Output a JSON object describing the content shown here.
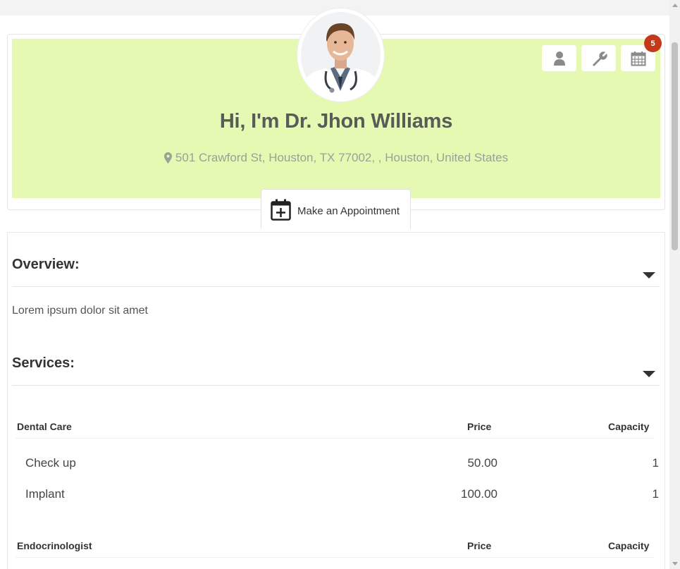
{
  "profile": {
    "name": "Hi, I'm Dr. Jhon Williams",
    "address": "501 Crawford St, Houston, TX 77002, , Houston, United States",
    "notification_count": "5"
  },
  "appointment": {
    "label": "Make an Appointment"
  },
  "overview": {
    "title": "Overview:",
    "text": "Lorem ipsum dolor sit amet"
  },
  "services": {
    "title": "Services:",
    "price_header": "Price",
    "capacity_header": "Capacity",
    "groups": [
      {
        "name": "Dental Care",
        "rows": [
          {
            "service": "Check up",
            "price": "50.00",
            "capacity": "1"
          },
          {
            "service": "Implant",
            "price": "100.00",
            "capacity": "1"
          }
        ]
      },
      {
        "name": "Endocrinologist",
        "rows": []
      }
    ]
  },
  "icons": {
    "profile": "user-icon",
    "settings": "wrench-icon",
    "calendar": "calendar-icon",
    "location": "map-marker-icon",
    "appointment": "calendar-plus-icon",
    "collapse": "caret-down-icon"
  },
  "colors": {
    "banner": "#e5f9b3",
    "badge": "#c5391b",
    "name": "#565c56",
    "address": "#9aa294"
  }
}
